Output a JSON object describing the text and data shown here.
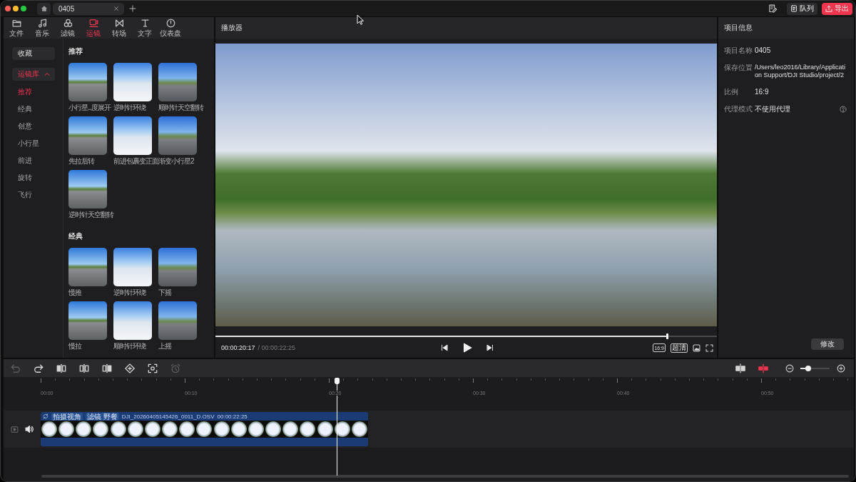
{
  "title_bar": {
    "tabs": [
      {
        "label": "0405",
        "selected": true
      }
    ],
    "buttons": [
      {
        "kind": "queue",
        "label": "队列"
      },
      {
        "kind": "export",
        "label": "导出"
      }
    ]
  },
  "toolbar": {
    "tabs": [
      {
        "kind": "file",
        "label": "文件",
        "selected": false
      },
      {
        "kind": "music",
        "label": "音乐",
        "selected": false
      },
      {
        "kind": "filter",
        "label": "滤镜",
        "selected": false
      },
      {
        "kind": "camera",
        "label": "运镜",
        "selected": true
      },
      {
        "kind": "transition",
        "label": "转场",
        "selected": false
      },
      {
        "kind": "text",
        "label": "文字",
        "selected": false
      },
      {
        "kind": "dashboard",
        "label": "仪表盘",
        "selected": false
      }
    ]
  },
  "sidebar": {
    "favorites": {
      "label": "收藏"
    },
    "library": {
      "label": "运镜库",
      "expanded": true,
      "children": [
        {
          "label": "推荐",
          "selected": true
        },
        {
          "label": "经典",
          "selected": false
        },
        {
          "label": "创意",
          "selected": false
        },
        {
          "label": "小行星",
          "selected": false
        },
        {
          "label": "前进",
          "selected": false
        },
        {
          "label": "旋转",
          "selected": false
        },
        {
          "label": "飞行",
          "selected": false
        }
      ]
    }
  },
  "effects": [
    {
      "title": "推荐",
      "items": [
        {
          "label": "小行星...度展开"
        },
        {
          "label": "逆时针环绕"
        },
        {
          "label": "顺时针天空翻转"
        },
        {
          "label": "先拉后转"
        },
        {
          "label": "前进包裹变正面"
        },
        {
          "label": "渐变小行星2"
        },
        {
          "label": "逆时针天空翻转"
        }
      ]
    },
    {
      "title": "经典",
      "items": [
        {
          "label": "慢推"
        },
        {
          "label": "逆时针环绕"
        },
        {
          "label": "下摇"
        },
        {
          "label": "慢拉"
        },
        {
          "label": "顺时针环绕"
        },
        {
          "label": "上摇"
        }
      ]
    }
  ],
  "player": {
    "title": "播放器",
    "progress": {
      "level": 0.9
    },
    "current_time": "00:00:20:17",
    "total_time": "/ 00:00:22:25",
    "controls": [
      {
        "kind": "ratio",
        "label": "16:9"
      },
      {
        "kind": "quality",
        "label": "超清"
      },
      {
        "kind": "snapshot"
      },
      {
        "kind": "fullscreen"
      }
    ]
  },
  "project_info": {
    "title": "项目信息",
    "fields": [
      {
        "label": "项目名称",
        "value": "0405"
      },
      {
        "label": "保存位置",
        "value": "/Users/leo2016/Library/Application Support/DJI Studio/project/2"
      },
      {
        "label": "比例",
        "value": "16:9"
      },
      {
        "label": "代理模式",
        "value": "不使用代理",
        "help": true
      }
    ],
    "edit_button": "修改"
  },
  "timeline": {
    "tools": [
      {
        "kind": "undo",
        "disabled": true
      },
      {
        "kind": "redo",
        "disabled": false
      },
      {
        "kind": "trim_start",
        "disabled": false
      },
      {
        "kind": "split",
        "disabled": false
      },
      {
        "kind": "trim_end",
        "disabled": false
      },
      {
        "kind": "keyframe",
        "disabled": false
      },
      {
        "kind": "focus",
        "disabled": false
      },
      {
        "kind": "timer",
        "disabled": true
      }
    ],
    "toggles": [
      {
        "kind": "snap",
        "on": false
      },
      {
        "kind": "link",
        "on": true
      }
    ],
    "zoom": {
      "level": 0.27
    },
    "ruler": [
      "00:00",
      "00:10",
      "00:20",
      "00:30",
      "00:40",
      "00:50"
    ],
    "playhead": {
      "level": 0.364
    },
    "clip": {
      "tags": [
        "拍摄视角",
        "滤镜 野餐"
      ],
      "file_name": "DJI_20260405145426_0011_D.OSV",
      "duration": "00:00:22:25"
    }
  }
}
